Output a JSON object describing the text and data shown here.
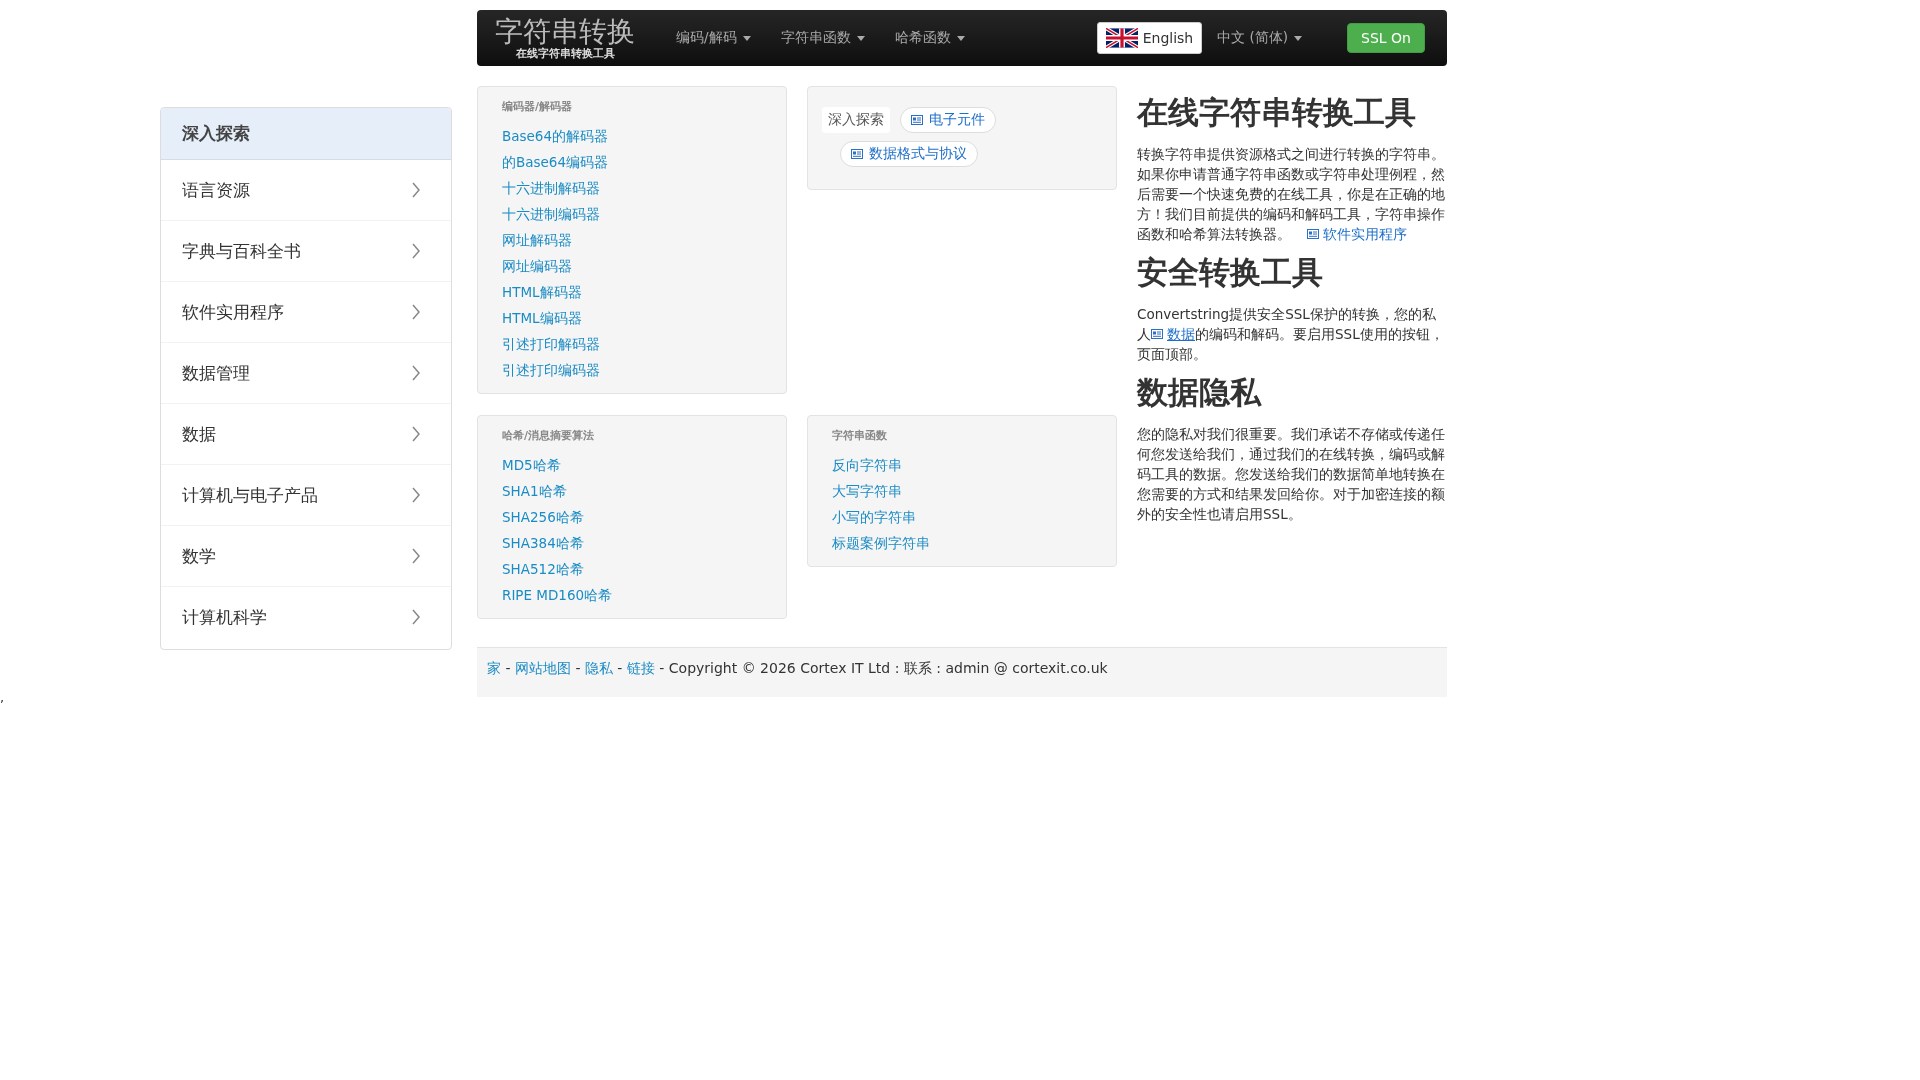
{
  "sidebar": {
    "title": "深入探索",
    "items": [
      {
        "label": "语言资源"
      },
      {
        "label": "字典与百科全书"
      },
      {
        "label": "软件实用程序"
      },
      {
        "label": "数据管理"
      },
      {
        "label": "数据"
      },
      {
        "label": "计算机与电子产品"
      },
      {
        "label": "数学"
      },
      {
        "label": "计算机科学"
      }
    ]
  },
  "navbar": {
    "brand": "字符串转换",
    "brand_subtitle": "在线字符串转换工具",
    "menus": [
      "编码/解码",
      "字符串函数",
      "哈希函数"
    ],
    "language_button": "English",
    "language_menu": "中文 (简体)",
    "ssl_button": "SSL On"
  },
  "cards": [
    {
      "heading": "编码器/解码器",
      "links": [
        "Base64的解码器",
        "的Base64编码器",
        "十六进制解码器",
        "十六进制编码器",
        "网址解码器",
        "网址编码器",
        "HTML解码器",
        "HTML编码器",
        "引述打印解码器",
        "引述打印编码器"
      ]
    },
    {
      "kind": "tags",
      "label": "深入探索",
      "tags": [
        "电子元件",
        "数据格式与协议"
      ]
    },
    {
      "heading": "哈希/消息摘要算法",
      "links": [
        "MD5哈希",
        "SHA1哈希",
        "SHA256哈希",
        "SHA384哈希",
        "SHA512哈希",
        "RIPE MD160哈希"
      ]
    },
    {
      "heading": "字符串函数",
      "links": [
        "反向字符串",
        "大写字符串",
        "小写的字符串",
        "标题案例字符串"
      ]
    }
  ],
  "sections": [
    {
      "heading": "在线字符串转换工具",
      "paragraph": [
        {
          "kind": "text",
          "text": "转换字符串提供资源格式之间进行转换的字符串。如果你申请普通字符串函数或字符串处理例程，然后需要一个快速免费的在线工具，你是在正确的地方！我们目前提供的编码和解码工具，字符串操作函数和哈希算法转换器。"
        },
        {
          "kind": "link",
          "text": "软件实用程序"
        }
      ]
    },
    {
      "heading": "安全转换工具",
      "paragraph": [
        {
          "kind": "text",
          "text": "Convertstring提供安全SSL保护的转换，您的私人"
        },
        {
          "kind": "link",
          "text": "数据",
          "underline": true
        },
        {
          "kind": "text",
          "text": "的编码和解码。要启用SSL使用的按钮，页面顶部。"
        }
      ]
    },
    {
      "heading": "数据隐私",
      "paragraph": [
        {
          "kind": "text",
          "text": "您的隐私对我们很重要。我们承诺不存储或传递任何您发送给我们，通过我们的在线转换，编码或解码工具的数据。您发送给我们的数据简单地转换在您需要的方式和结果发回给你。对于加密连接的额外的安全性也请启用SSL。"
        }
      ]
    }
  ],
  "footer": [
    {
      "kind": "link",
      "text": "家"
    },
    {
      "kind": "text",
      "text": " - "
    },
    {
      "kind": "link",
      "text": "网站地图"
    },
    {
      "kind": "text",
      "text": " - "
    },
    {
      "kind": "link",
      "text": "隐私"
    },
    {
      "kind": "text",
      "text": " - "
    },
    {
      "kind": "link",
      "text": "链接"
    },
    {
      "kind": "text",
      "text": " - Copyright © 2026 Cortex IT Ltd : 联系 : admin @ cortexit.co.uk"
    }
  ],
  "stray_text": ","
}
